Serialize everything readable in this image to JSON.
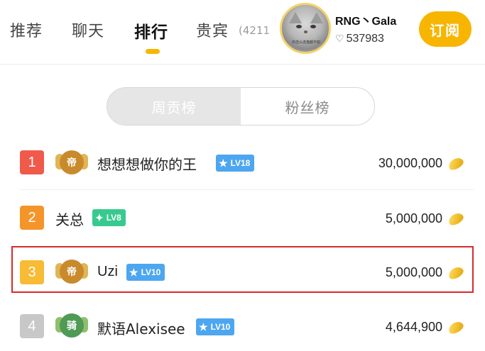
{
  "tabs": [
    {
      "label": "推荐",
      "active": false
    },
    {
      "label": "聊天",
      "active": false
    },
    {
      "label": "排行",
      "active": true
    },
    {
      "label": "贵宾",
      "active": false
    }
  ],
  "vip_count": "(4211",
  "anchor": {
    "name": "RNG丶Gala",
    "fans": "537983",
    "heart_icon": "heart-outline-icon",
    "subscribe_label": "订阅",
    "avatar_caption": "你怎么连猫都不如"
  },
  "segments": [
    {
      "label": "周贡榜",
      "active": true
    },
    {
      "label": "粉丝榜",
      "active": false
    }
  ],
  "ranking": [
    {
      "rank": "1",
      "rank_color": "#f05a4a",
      "medal": "帝",
      "medal_color": "#c98a2c",
      "name": "想想想做你的王",
      "level": "LV18",
      "level_color": "#4da6f0",
      "level_icon": "star-icon",
      "amount": "30,000,000"
    },
    {
      "rank": "2",
      "rank_color": "#f4952a",
      "medal": "",
      "medal_color": "",
      "name": "关总",
      "level": "LV8",
      "level_color": "#38c98f",
      "level_icon": "sparkle-icon",
      "amount": "5,000,000"
    },
    {
      "rank": "3",
      "rank_color": "#f7bb35",
      "medal": "帝",
      "medal_color": "#c98a2c",
      "name": "Uzi",
      "level": "LV10",
      "level_color": "#4da6f0",
      "level_icon": "star-icon",
      "amount": "5,000,000"
    },
    {
      "rank": "4",
      "rank_color": "#c8c8c8",
      "medal": "骑",
      "medal_color": "#4f9a55",
      "name": "默语Alexisee",
      "level": "LV10",
      "level_color": "#4da6f0",
      "level_icon": "star-icon",
      "amount": "4,644,900"
    }
  ],
  "coin_icon": "gold-coin-icon",
  "accent_color": "#f7b500",
  "highlight_color": "#d62b2b"
}
